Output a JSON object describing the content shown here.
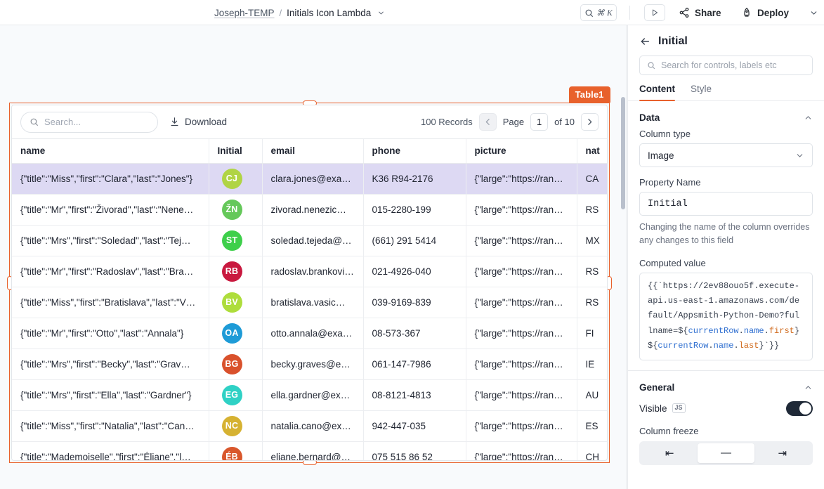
{
  "topbar": {
    "workspace": "Joseph-TEMP",
    "separator": "/",
    "page": "Initials Icon Lambda",
    "search_kbd": "⌘ K",
    "share_label": "Share",
    "deploy_label": "Deploy",
    "icons": {
      "search": "search-icon",
      "play": "play-icon",
      "share": "share-nodes-icon",
      "deploy": "rocket-icon",
      "caret": "chevron-down-icon"
    }
  },
  "canvas": {
    "widget_label": "Table1",
    "accent_color": "#e8612c"
  },
  "table": {
    "search_placeholder": "Search...",
    "search_value": "",
    "download_label": "Download",
    "records_label": "100 Records",
    "page_label": "Page",
    "page_value": "1",
    "of_label": "of 10",
    "prev_icon": "chevron-left-icon",
    "next_icon": "chevron-right-icon",
    "columns": [
      "name",
      "Initial",
      "email",
      "phone",
      "picture",
      "nat"
    ],
    "rows": [
      {
        "name": "{\"title\":\"Miss\",\"first\":\"Clara\",\"last\":\"Jones\"}",
        "initials": "CJ",
        "color": "#b0d444",
        "email": "clara.jones@exam…",
        "phone": "K36 R94-2176",
        "picture": "{\"large\":\"https://ran…",
        "nat": "CA",
        "selected": true
      },
      {
        "name": "{\"title\":\"Mr\",\"first\":\"Živorad\",\"last\":\"Nene…",
        "initials": "ŽN",
        "color": "#65c85a",
        "email": "zivorad.nenezic@…",
        "phone": "015-2280-199",
        "picture": "{\"large\":\"https://ran…",
        "nat": "RS",
        "selected": false
      },
      {
        "name": "{\"title\":\"Mrs\",\"first\":\"Soledad\",\"last\":\"Tej…",
        "initials": "ST",
        "color": "#3ecf4b",
        "email": "soledad.tejeda@e…",
        "phone": "(661) 291 5414",
        "picture": "{\"large\":\"https://ran…",
        "nat": "MX",
        "selected": false
      },
      {
        "name": "{\"title\":\"Mr\",\"first\":\"Radoslav\",\"last\":\"Bra…",
        "initials": "RB",
        "color": "#c9193f",
        "email": "radoslav.brankovic…",
        "phone": "021-4926-040",
        "picture": "{\"large\":\"https://ran…",
        "nat": "RS",
        "selected": false
      },
      {
        "name": "{\"title\":\"Miss\",\"first\":\"Bratislava\",\"last\":\"V…",
        "initials": "BV",
        "color": "#aedd3c",
        "email": "bratislava.vasic@…",
        "phone": "039-9169-839",
        "picture": "{\"large\":\"https://ran…",
        "nat": "RS",
        "selected": false
      },
      {
        "name": "{\"title\":\"Mr\",\"first\":\"Otto\",\"last\":\"Annala\"}",
        "initials": "OA",
        "color": "#1e9bd7",
        "email": "otto.annala@exa…",
        "phone": "08-573-367",
        "picture": "{\"large\":\"https://ran…",
        "nat": "FI",
        "selected": false
      },
      {
        "name": "{\"title\":\"Mrs\",\"first\":\"Becky\",\"last\":\"Grav…",
        "initials": "BG",
        "color": "#d9512c",
        "email": "becky.graves@ex…",
        "phone": "061-147-7986",
        "picture": "{\"large\":\"https://ran…",
        "nat": "IE",
        "selected": false
      },
      {
        "name": "{\"title\":\"Mrs\",\"first\":\"Ella\",\"last\":\"Gardner\"}",
        "initials": "EG",
        "color": "#2fd1c5",
        "email": "ella.gardner@exa…",
        "phone": "08-8121-4813",
        "picture": "{\"large\":\"https://ran…",
        "nat": "AU",
        "selected": false
      },
      {
        "name": "{\"title\":\"Miss\",\"first\":\"Natalia\",\"last\":\"Can…",
        "initials": "NC",
        "color": "#d6b232",
        "email": "natalia.cano@exa…",
        "phone": "942-447-035",
        "picture": "{\"large\":\"https://ran…",
        "nat": "ES",
        "selected": false
      },
      {
        "name": "{\"title\":\"Mademoiselle\",\"first\":\"Éliane\",\"l…",
        "initials": "ÉB",
        "color": "#d9572c",
        "email": "eliane.bernard@e…",
        "phone": "075 515 86 52",
        "picture": "{\"large\":\"https://ran…",
        "nat": "CH",
        "selected": false
      }
    ]
  },
  "panel": {
    "title": "Initial",
    "back_icon": "arrow-left-icon",
    "search_placeholder": "Search for controls, labels etc",
    "search_value": "",
    "tabs": [
      {
        "label": "Content",
        "active": true
      },
      {
        "label": "Style",
        "active": false
      }
    ],
    "data_section": {
      "title": "Data",
      "column_type_label": "Column type",
      "column_type_value": "Image",
      "property_name_label": "Property Name",
      "property_name_value": "Initial",
      "property_helper": "Changing the name of the column overrides any changes to this field",
      "computed_value_label": "Computed value",
      "computed_value": "{{`https://2ev88ouo5f.execute-api.us-east-1.amazonaws.com/default/Appsmith-Python-Demo?fullname=${currentRow.name.first} ${currentRow.name.last}`}}",
      "computed_parts": [
        {
          "text": "{{`https://2ev88ouo5f.execute-api.us-east-1.amazonaws.com/default/Appsmith-Python-Demo?fullname=${",
          "style": "plain"
        },
        {
          "text": "currentRow",
          "style": "blue"
        },
        {
          "text": ".",
          "style": "plain"
        },
        {
          "text": "name",
          "style": "blue"
        },
        {
          "text": ".",
          "style": "plain"
        },
        {
          "text": "first",
          "style": "orange"
        },
        {
          "text": "} ${",
          "style": "plain"
        },
        {
          "text": "currentRow",
          "style": "blue"
        },
        {
          "text": ".",
          "style": "plain"
        },
        {
          "text": "name",
          "style": "blue"
        },
        {
          "text": ".",
          "style": "plain"
        },
        {
          "text": "last",
          "style": "orange"
        },
        {
          "text": "}`}}",
          "style": "plain"
        }
      ]
    },
    "general_section": {
      "title": "General",
      "visible_label": "Visible",
      "visible_badge": "JS",
      "visible_on": true,
      "column_freeze_label": "Column freeze",
      "freeze_options": [
        {
          "icon": "freeze-left-icon",
          "glyph": "⇤",
          "selected": false
        },
        {
          "icon": "no-freeze-icon",
          "glyph": "—",
          "selected": true
        },
        {
          "icon": "freeze-right-icon",
          "glyph": "⇥",
          "selected": false
        }
      ]
    }
  }
}
